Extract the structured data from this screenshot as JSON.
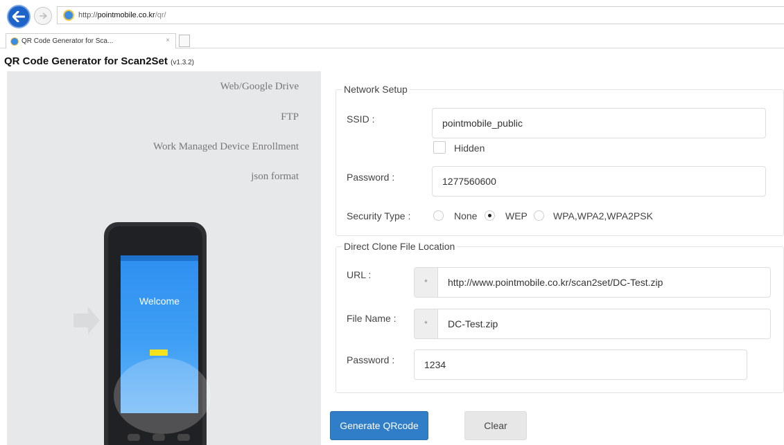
{
  "browser": {
    "url_scheme": "http://",
    "url_host": "pointmobile.co.kr",
    "url_path": "/qr/",
    "tab_title": "QR Code Generator for Sca...",
    "tab_close": "×"
  },
  "page": {
    "title": "QR Code Generator for Scan2Set",
    "version": "(v1.3.2)"
  },
  "sidebar": {
    "items": [
      {
        "label": "Web/Google Drive"
      },
      {
        "label": "FTP"
      },
      {
        "label": "Work Managed Device Enrollment"
      },
      {
        "label": "json format"
      }
    ]
  },
  "phone_screen": {
    "welcome_text": "Welcome"
  },
  "network": {
    "legend": "Network Setup",
    "ssid_label": "SSID :",
    "ssid_value": "pointmobile_public",
    "hidden_label": "Hidden",
    "password_label": "Password :",
    "password_value": "1277560600",
    "security_label": "Security Type :",
    "security_options": [
      "None",
      "WEP",
      "WPA,WPA2,WPA2PSK"
    ],
    "security_selected": "WEP"
  },
  "clone": {
    "legend": "Direct Clone File Location",
    "url_label": "URL :",
    "url_required": "*",
    "url_value": "http://www.pointmobile.co.kr/scan2set/DC-Test.zip",
    "filename_label": "File Name :",
    "filename_required": "*",
    "filename_value": "DC-Test.zip",
    "password_label": "Password :",
    "password_value": "1234"
  },
  "actions": {
    "generate_label": "Generate QRcode",
    "clear_label": "Clear"
  },
  "colors": {
    "primary": "#2f7ec7",
    "panel_bg": "#e6e8ea",
    "back_button": "#1e63c7"
  }
}
